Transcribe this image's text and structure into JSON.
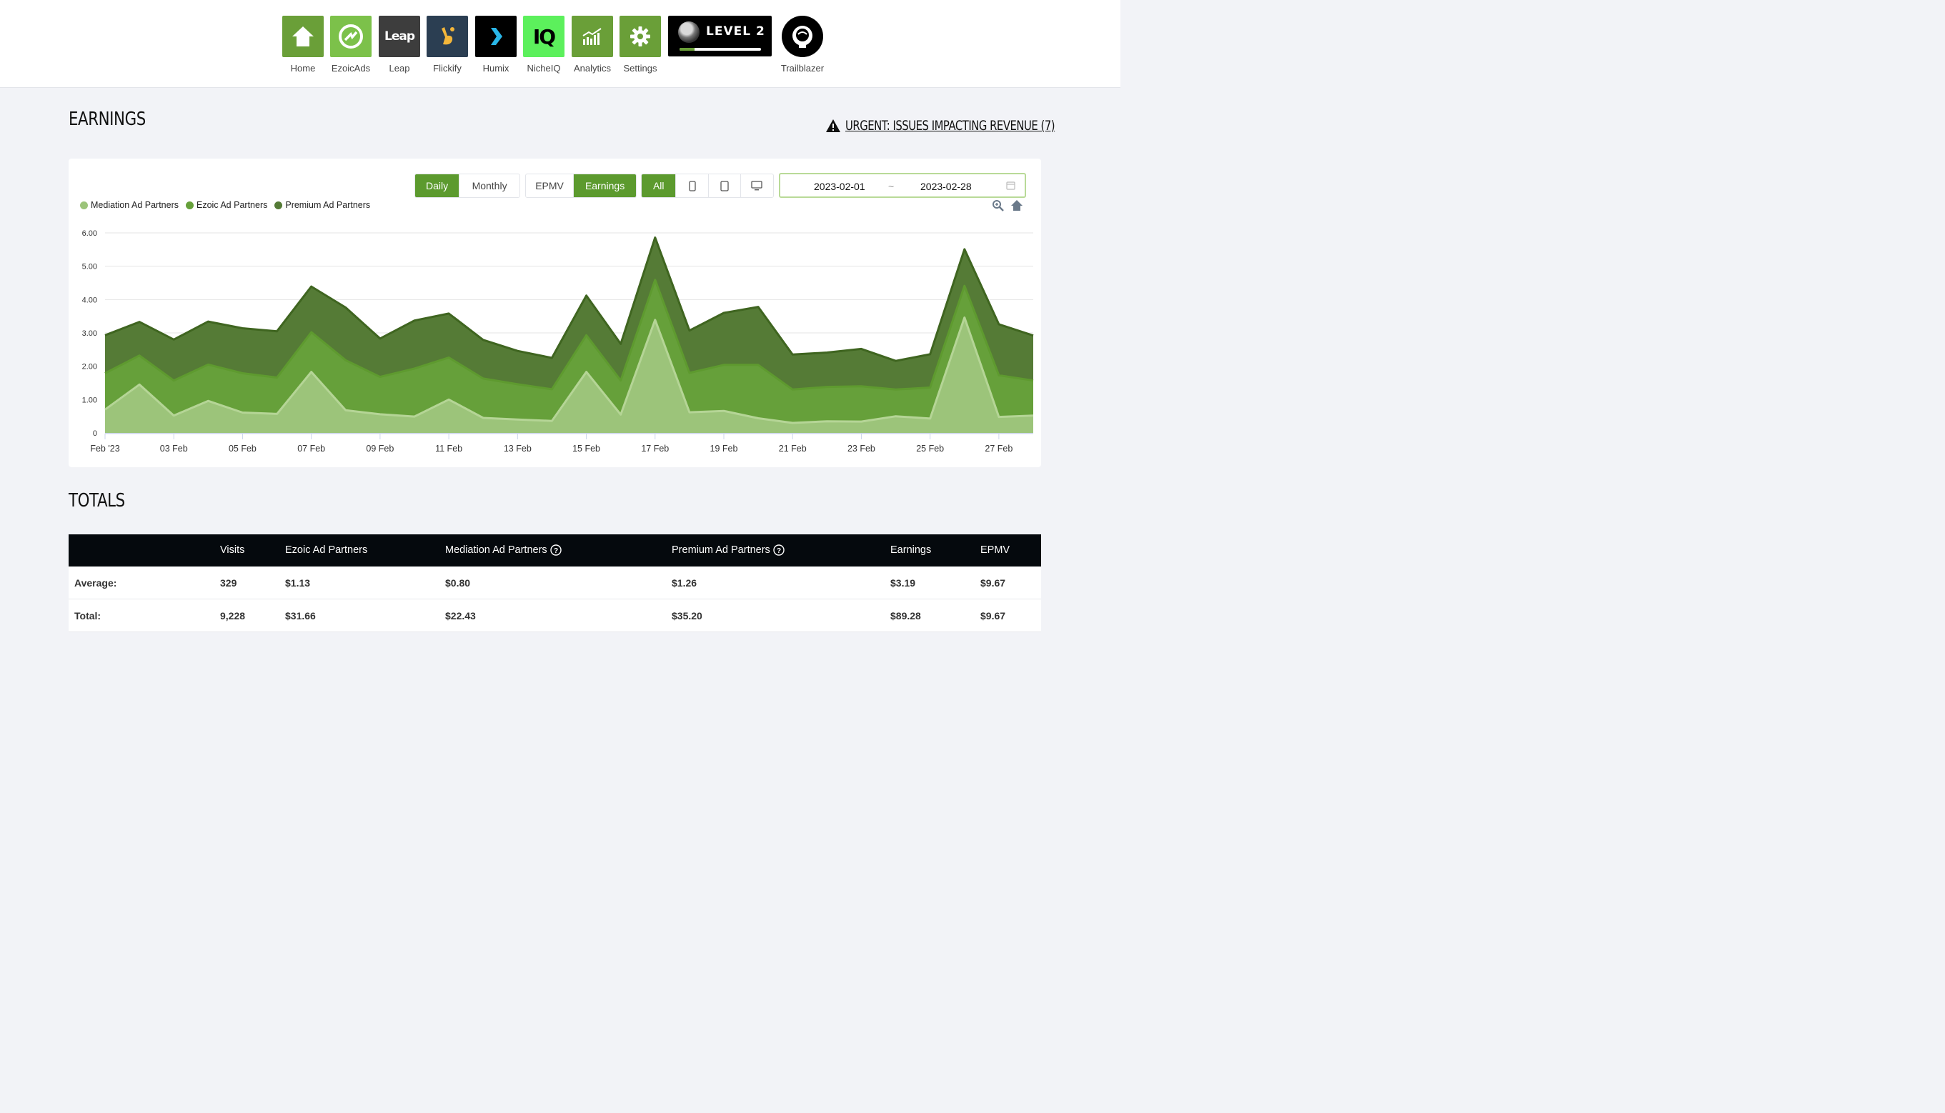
{
  "nav": {
    "apps": [
      {
        "label": "Home",
        "icon": "home-icon",
        "color": "#6a9f38"
      },
      {
        "label": "EzoicAds",
        "icon": "ezoicads-icon",
        "color": "#7cc14a"
      },
      {
        "label": "Leap",
        "icon": "leap-icon",
        "color": "#3d3d3d",
        "text": "Leap"
      },
      {
        "label": "Flickify",
        "icon": "flickify-icon",
        "color": "#2b3e52"
      },
      {
        "label": "Humix",
        "icon": "humix-icon",
        "color": "#000000"
      },
      {
        "label": "NicheIQ",
        "icon": "nicheiq-icon",
        "color": "#5cf05c",
        "text": "IQ"
      },
      {
        "label": "Analytics",
        "icon": "analytics-icon",
        "color": "#6a9f38"
      },
      {
        "label": "Settings",
        "icon": "gear-icon",
        "color": "#6a9f38"
      }
    ],
    "level": {
      "text": "LEVEL 2",
      "progress": 0.18
    },
    "trailblazer": {
      "label": "Trailblazer",
      "icon": "astronaut-icon"
    }
  },
  "earnings": {
    "title": "EARNINGS",
    "urgent_link": "URGENT: ISSUES IMPACTING REVENUE (7)",
    "period_options": [
      "Daily",
      "Monthly"
    ],
    "period_selected": "Daily",
    "metric_options": [
      "EPMV",
      "Earnings"
    ],
    "metric_selected": "Earnings",
    "device_options": [
      {
        "label": "All",
        "icon": ""
      },
      {
        "label": "",
        "icon": "mobile-icon"
      },
      {
        "label": "",
        "icon": "tablet-icon"
      },
      {
        "label": "",
        "icon": "desktop-icon"
      }
    ],
    "device_selected": "All",
    "date_start": "2023-02-01",
    "date_separator": "~",
    "date_end": "2023-02-28",
    "tools": [
      "zoom-icon",
      "reset-home-icon"
    ]
  },
  "chart_data": {
    "type": "area",
    "stacked": true,
    "x": [
      "2023-02-01",
      "2023-02-02",
      "2023-02-03",
      "2023-02-04",
      "2023-02-05",
      "2023-02-06",
      "2023-02-07",
      "2023-02-08",
      "2023-02-09",
      "2023-02-10",
      "2023-02-11",
      "2023-02-12",
      "2023-02-13",
      "2023-02-14",
      "2023-02-15",
      "2023-02-16",
      "2023-02-17",
      "2023-02-18",
      "2023-02-19",
      "2023-02-20",
      "2023-02-21",
      "2023-02-22",
      "2023-02-23",
      "2023-02-24",
      "2023-02-25",
      "2023-02-26",
      "2023-02-27",
      "2023-02-28"
    ],
    "x_tick_labels": [
      "Feb '23",
      "03 Feb",
      "05 Feb",
      "07 Feb",
      "09 Feb",
      "11 Feb",
      "13 Feb",
      "15 Feb",
      "17 Feb",
      "19 Feb",
      "21 Feb",
      "23 Feb",
      "25 Feb",
      "27 Feb"
    ],
    "series": [
      {
        "name": "Mediation Ad Partners",
        "color": "#9cc47a",
        "values": [
          0.7,
          1.45,
          0.52,
          0.96,
          0.61,
          0.57,
          1.83,
          0.68,
          0.56,
          0.49,
          1.0,
          0.45,
          0.4,
          0.36,
          1.83,
          0.55,
          3.39,
          0.62,
          0.66,
          0.44,
          0.3,
          0.35,
          0.34,
          0.5,
          0.43,
          3.46,
          0.48,
          0.52
        ]
      },
      {
        "name": "Ezoic Ad Partners",
        "color": "#66a03a",
        "values": [
          1.09,
          0.87,
          1.05,
          1.09,
          1.18,
          1.09,
          1.19,
          1.5,
          1.12,
          1.44,
          1.26,
          1.18,
          1.06,
          0.95,
          1.1,
          1.02,
          1.2,
          1.18,
          1.38,
          1.6,
          1.0,
          1.03,
          1.06,
          0.8,
          0.93,
          0.95,
          1.25,
          1.05
        ]
      },
      {
        "name": "Premium Ad Partners",
        "color": "#557b36",
        "values": [
          1.14,
          1.01,
          1.23,
          1.29,
          1.35,
          1.39,
          1.37,
          1.58,
          1.15,
          1.44,
          1.32,
          1.16,
          1.0,
          0.94,
          1.19,
          1.1,
          1.27,
          1.27,
          1.56,
          1.74,
          1.05,
          1.03,
          1.12,
          0.86,
          1.0,
          1.1,
          1.53,
          1.35
        ]
      }
    ],
    "ylim": [
      0,
      6
    ],
    "y_ticks": [
      "0",
      "1.00",
      "2.00",
      "3.00",
      "4.00",
      "5.00",
      "6.00"
    ],
    "grid": true,
    "legend_position": "top-left"
  },
  "totals": {
    "title": "TOTALS",
    "columns": [
      "",
      "Visits",
      "Ezoic Ad Partners",
      "Mediation Ad Partners",
      "Premium Ad Partners",
      "Earnings",
      "EPMV"
    ],
    "rows": [
      [
        "Average:",
        "329",
        "$1.13",
        "$0.80",
        "$1.26",
        "$3.19",
        "$9.67"
      ],
      [
        "Total:",
        "9,228",
        "$31.66",
        "$22.43",
        "$35.20",
        "$89.28",
        "$9.67"
      ]
    ]
  }
}
